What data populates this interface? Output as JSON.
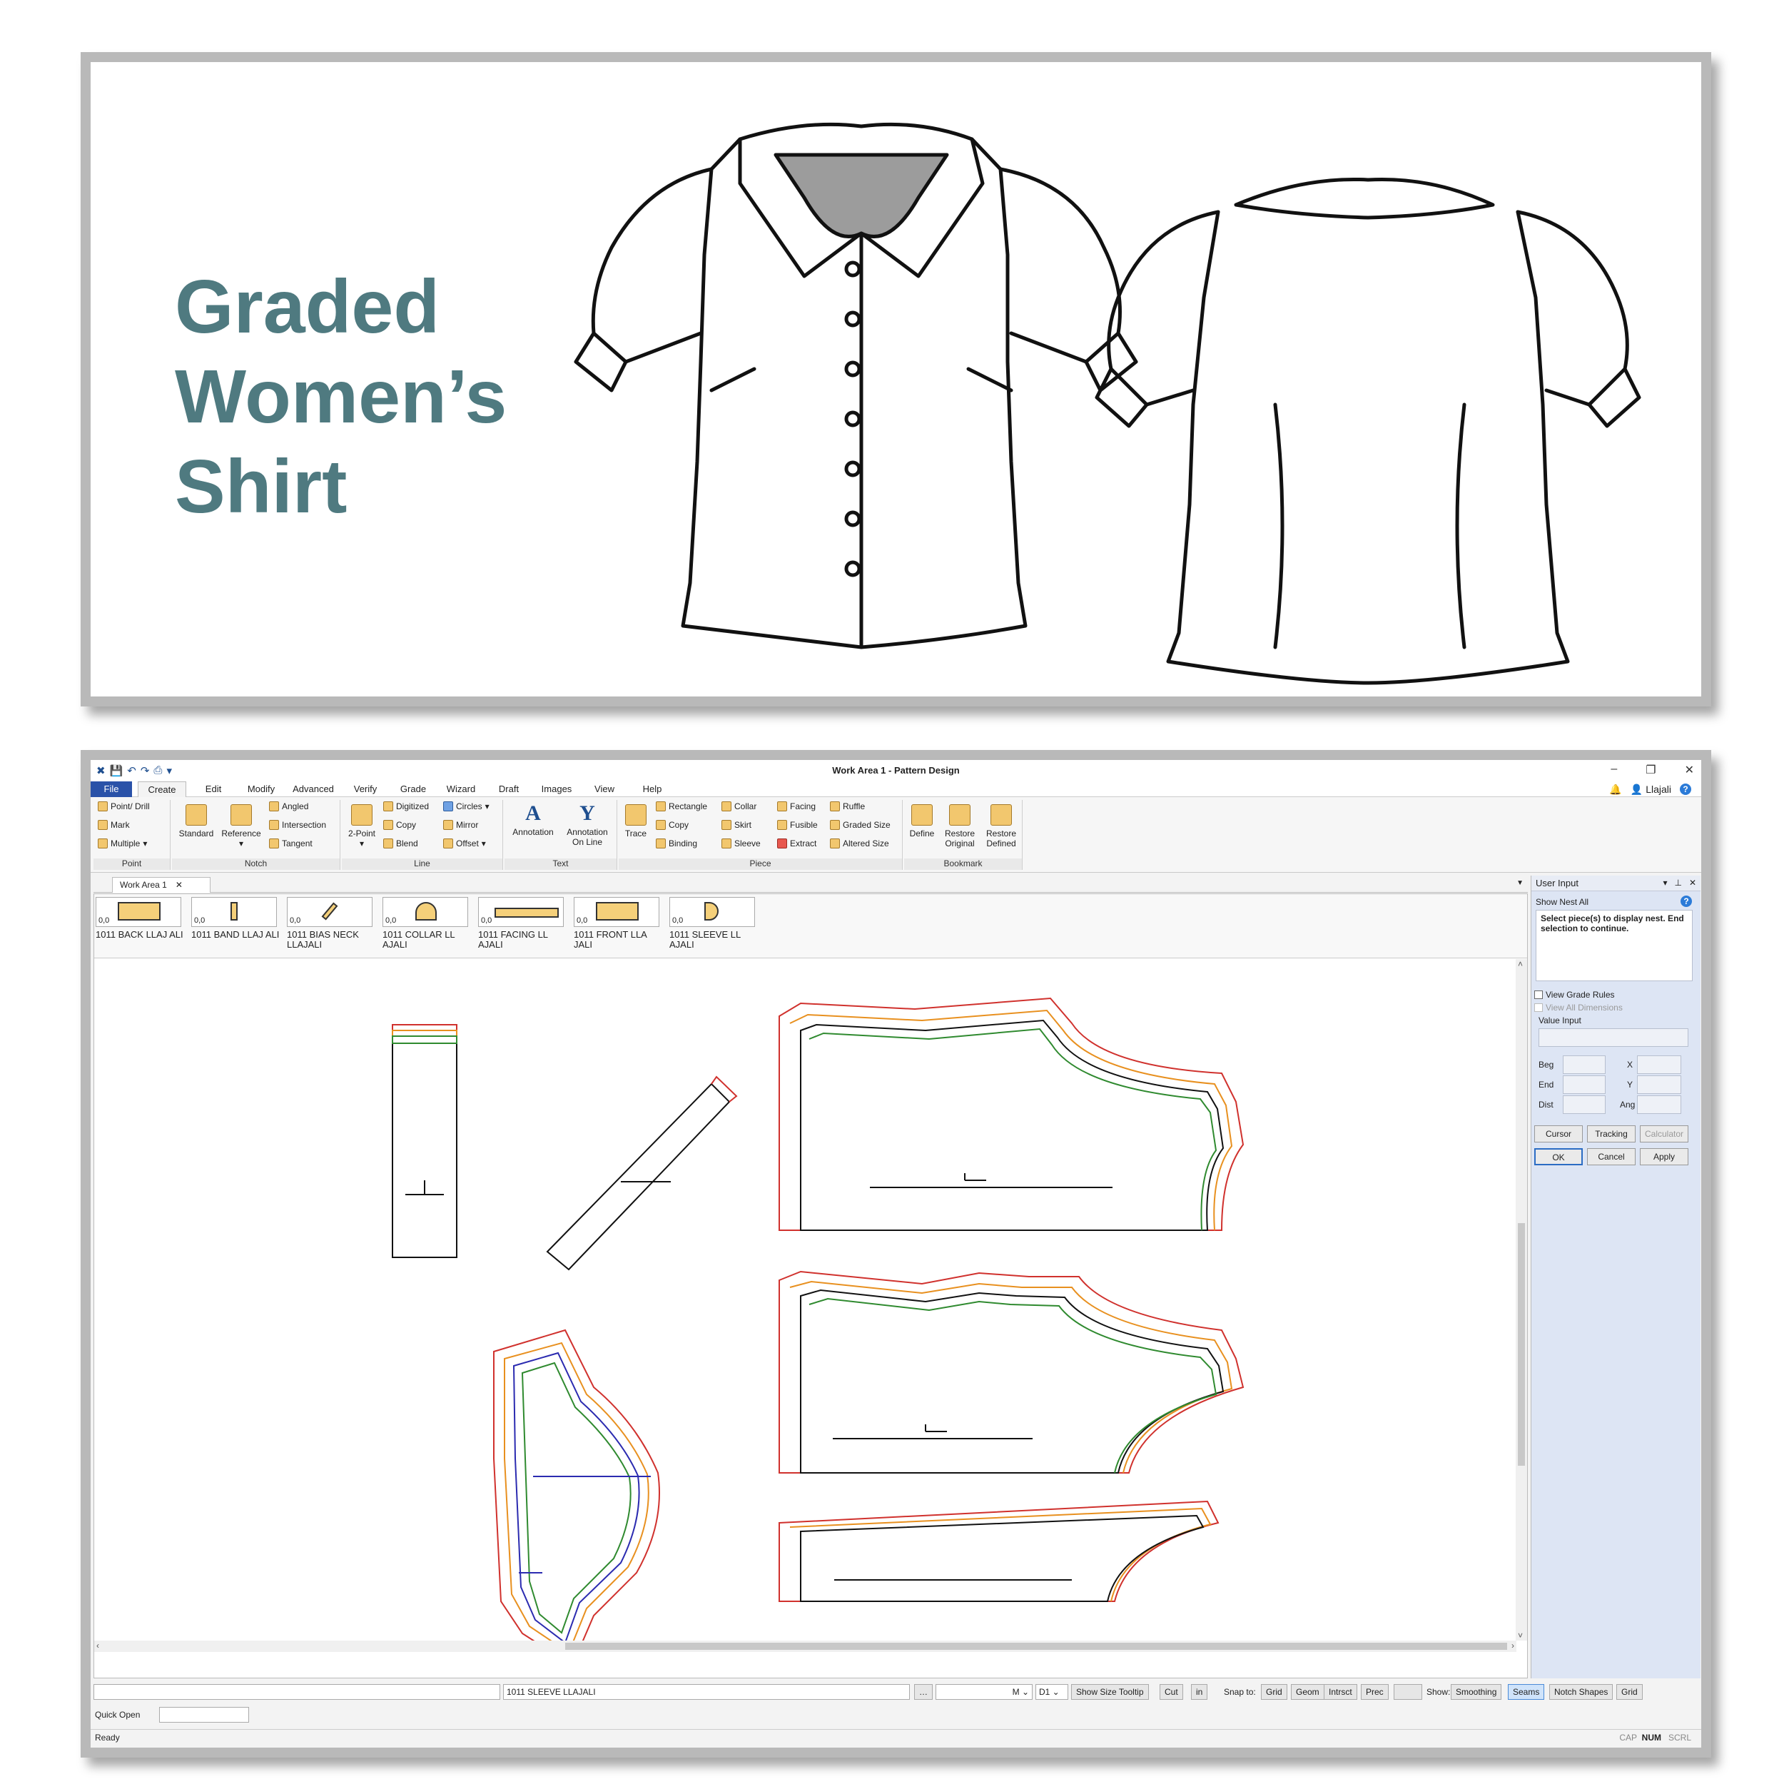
{
  "headline": [
    "Graded",
    "Women’s",
    "Shirt"
  ],
  "app": {
    "title": "Work Area 1 - Pattern Design",
    "user": "Llajali",
    "menu": [
      "File",
      "Create",
      "Edit",
      "Modify",
      "Advanced",
      "Verify",
      "Grade",
      "Wizard",
      "Draft",
      "Images",
      "View",
      "Help"
    ],
    "ribbon": {
      "point": {
        "name": "Point",
        "items": [
          "Point/ Drill",
          "Mark",
          "Multiple"
        ]
      },
      "notch": {
        "name": "Notch",
        "big": [
          "Standard",
          "Reference"
        ],
        "items": [
          "Angled",
          "Intersection",
          "Tangent"
        ]
      },
      "line": {
        "name": "Line",
        "big": [
          "2-Point"
        ],
        "items": [
          "Digitized",
          "Copy",
          "Blend",
          "Circles",
          "Mirror",
          "Offset"
        ]
      },
      "text": {
        "name": "Text",
        "big": [
          "Annotation",
          "Annotation On Line"
        ]
      },
      "piece": {
        "name": "Piece",
        "big": [
          "Trace"
        ],
        "items": [
          "Rectangle",
          "Copy",
          "Binding",
          "Collar",
          "Skirt",
          "Sleeve",
          "Facing",
          "Fusible",
          "Extract",
          "Ruffle",
          "Graded Size",
          "Altered Size"
        ]
      },
      "bookmark": {
        "name": "Bookmark",
        "big": [
          "Define",
          "Restore Original",
          "Restore Defined"
        ]
      }
    },
    "tab": "Work Area 1",
    "pieces": [
      {
        "qty": "0,0",
        "name": "1011 BACK LLAJ ALI"
      },
      {
        "qty": "0,0",
        "name": "1011 BAND LLAJ ALI"
      },
      {
        "qty": "0,0",
        "name": "1011 BIAS NECK LLAJALI"
      },
      {
        "qty": "0,0",
        "name": "1011 COLLAR LL AJALI"
      },
      {
        "qty": "0,0",
        "name": "1011 FACING LL AJALI"
      },
      {
        "qty": "0,0",
        "name": "1011 FRONT LLA JALI"
      },
      {
        "qty": "0,0",
        "name": "1011 SLEEVE LL AJALI"
      }
    ],
    "status": {
      "current_piece": "1011 SLEEVE LLAJALI",
      "size": "M",
      "d": "D1",
      "show_size_tooltip": "Show Size Tooltip",
      "cut": "Cut",
      "unit": "in",
      "snap_to": "Snap to:",
      "snap": [
        "Grid",
        "Geom",
        "Intrsct",
        "Prec"
      ],
      "show": "Show:",
      "show_opts": [
        "Smoothing",
        "Seams",
        "Notch Shapes",
        "Grid"
      ],
      "quick_open": "Quick Open",
      "ready": "Ready",
      "keys": [
        "CAP",
        "NUM",
        "SCRL"
      ]
    },
    "user_input": {
      "title": "User Input",
      "sub": "Show Nest All",
      "message": "Select piece(s) to display nest. End selection to continue.",
      "view_grade_rules": "View Grade Rules",
      "view_all_dimensions": "View All Dimensions",
      "value_input": "Value Input",
      "beg": "Beg",
      "end": "End",
      "dist": "Dist",
      "x": "X",
      "y": "Y",
      "ang": "Ang",
      "cursor": "Cursor",
      "tracking": "Tracking",
      "calculator": "Calculator",
      "ok": "OK",
      "cancel": "Cancel",
      "apply": "Apply"
    }
  },
  "colors": {
    "headline": "#4f7a80",
    "accent": "#2a52a8",
    "grade_red": "#d0312d",
    "grade_orange": "#e8901f",
    "grade_green": "#2f8a2f",
    "grade_blue": "#2b2bb0"
  }
}
